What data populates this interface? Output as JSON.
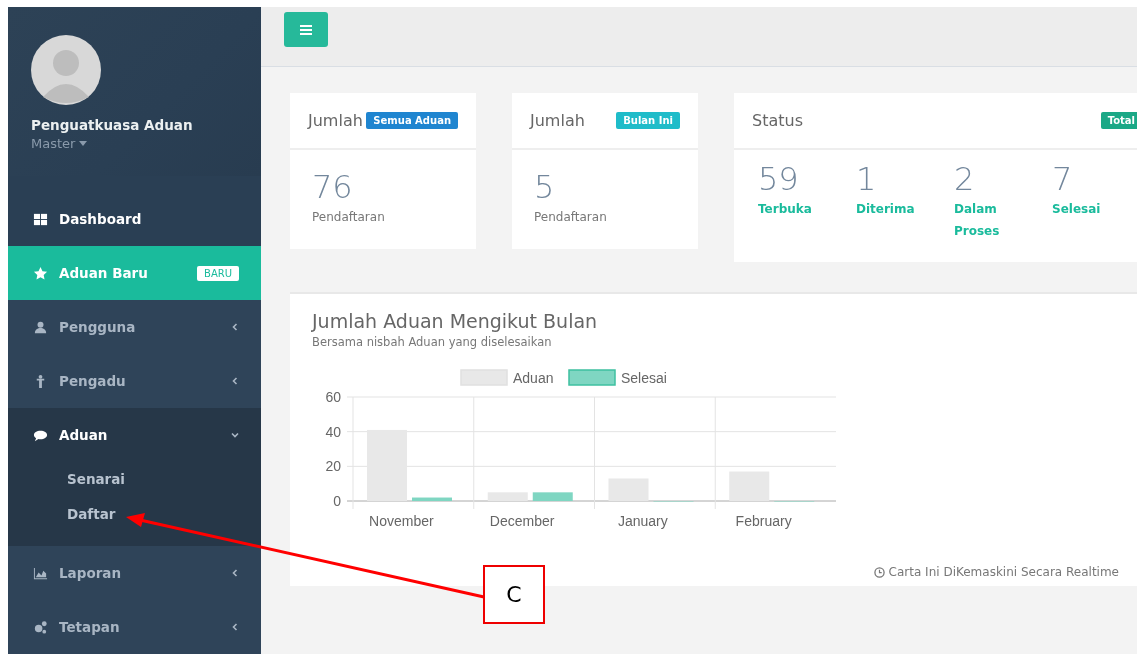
{
  "sidebar": {
    "profile": {
      "name": "Penguatkuasa Aduan",
      "role": "Master"
    },
    "items": [
      {
        "label": "Dashboard",
        "kind": "link",
        "selected": false
      },
      {
        "label": "Aduan Baru",
        "kind": "link",
        "selected": true,
        "badge": "BARU"
      },
      {
        "label": "Pengguna",
        "kind": "menu",
        "selected": false,
        "expanded": false
      },
      {
        "label": "Pengadu",
        "kind": "menu",
        "selected": false,
        "expanded": false
      },
      {
        "label": "Aduan",
        "kind": "menu",
        "selected": false,
        "expanded": true,
        "children": [
          {
            "label": "Senarai",
            "selected": false
          },
          {
            "label": "Daftar",
            "selected": false
          }
        ]
      },
      {
        "label": "Laporan",
        "kind": "menu",
        "selected": false,
        "expanded": false
      },
      {
        "label": "Tetapan",
        "kind": "menu",
        "selected": false,
        "expanded": false
      }
    ]
  },
  "cards": [
    {
      "title": "Jumlah",
      "badge": "Semua Aduan",
      "color": "#1f85d0",
      "value": "76",
      "caption": "Pendaftaran"
    },
    {
      "title": "Jumlah",
      "badge": "Bulan Ini",
      "color": "#1fbcc9",
      "value": "5",
      "caption": "Pendaftaran"
    }
  ],
  "status": {
    "title": "Status",
    "badge": "Total",
    "color": "#1ba886",
    "stats": [
      {
        "value": "59",
        "label": "Terbuka"
      },
      {
        "value": "1",
        "label": "Diterima"
      },
      {
        "value": "2",
        "label": "Dalam Proses"
      },
      {
        "value": "7",
        "label": "Selesai"
      }
    ]
  },
  "chart_panel": {
    "title": "Jumlah Aduan Mengikut Bulan",
    "subtitle": "Bersama nisbah Aduan yang diselesaikan",
    "footer": "Carta Ini DiKemaskini Secara Realtime",
    "chart_data": {
      "type": "bar",
      "categories": [
        "November",
        "December",
        "January",
        "February"
      ],
      "series": [
        {
          "name": "Aduan",
          "color": "#e8e8e8",
          "values": [
            41,
            5,
            13,
            17
          ]
        },
        {
          "name": "Selesai",
          "color": "#7fd6c2",
          "values": [
            2,
            5,
            0,
            0
          ]
        }
      ],
      "legend": "top",
      "ylim": [
        0,
        60
      ],
      "yticks": [
        0,
        20,
        40,
        60
      ]
    }
  },
  "annotation": {
    "label": "C"
  }
}
